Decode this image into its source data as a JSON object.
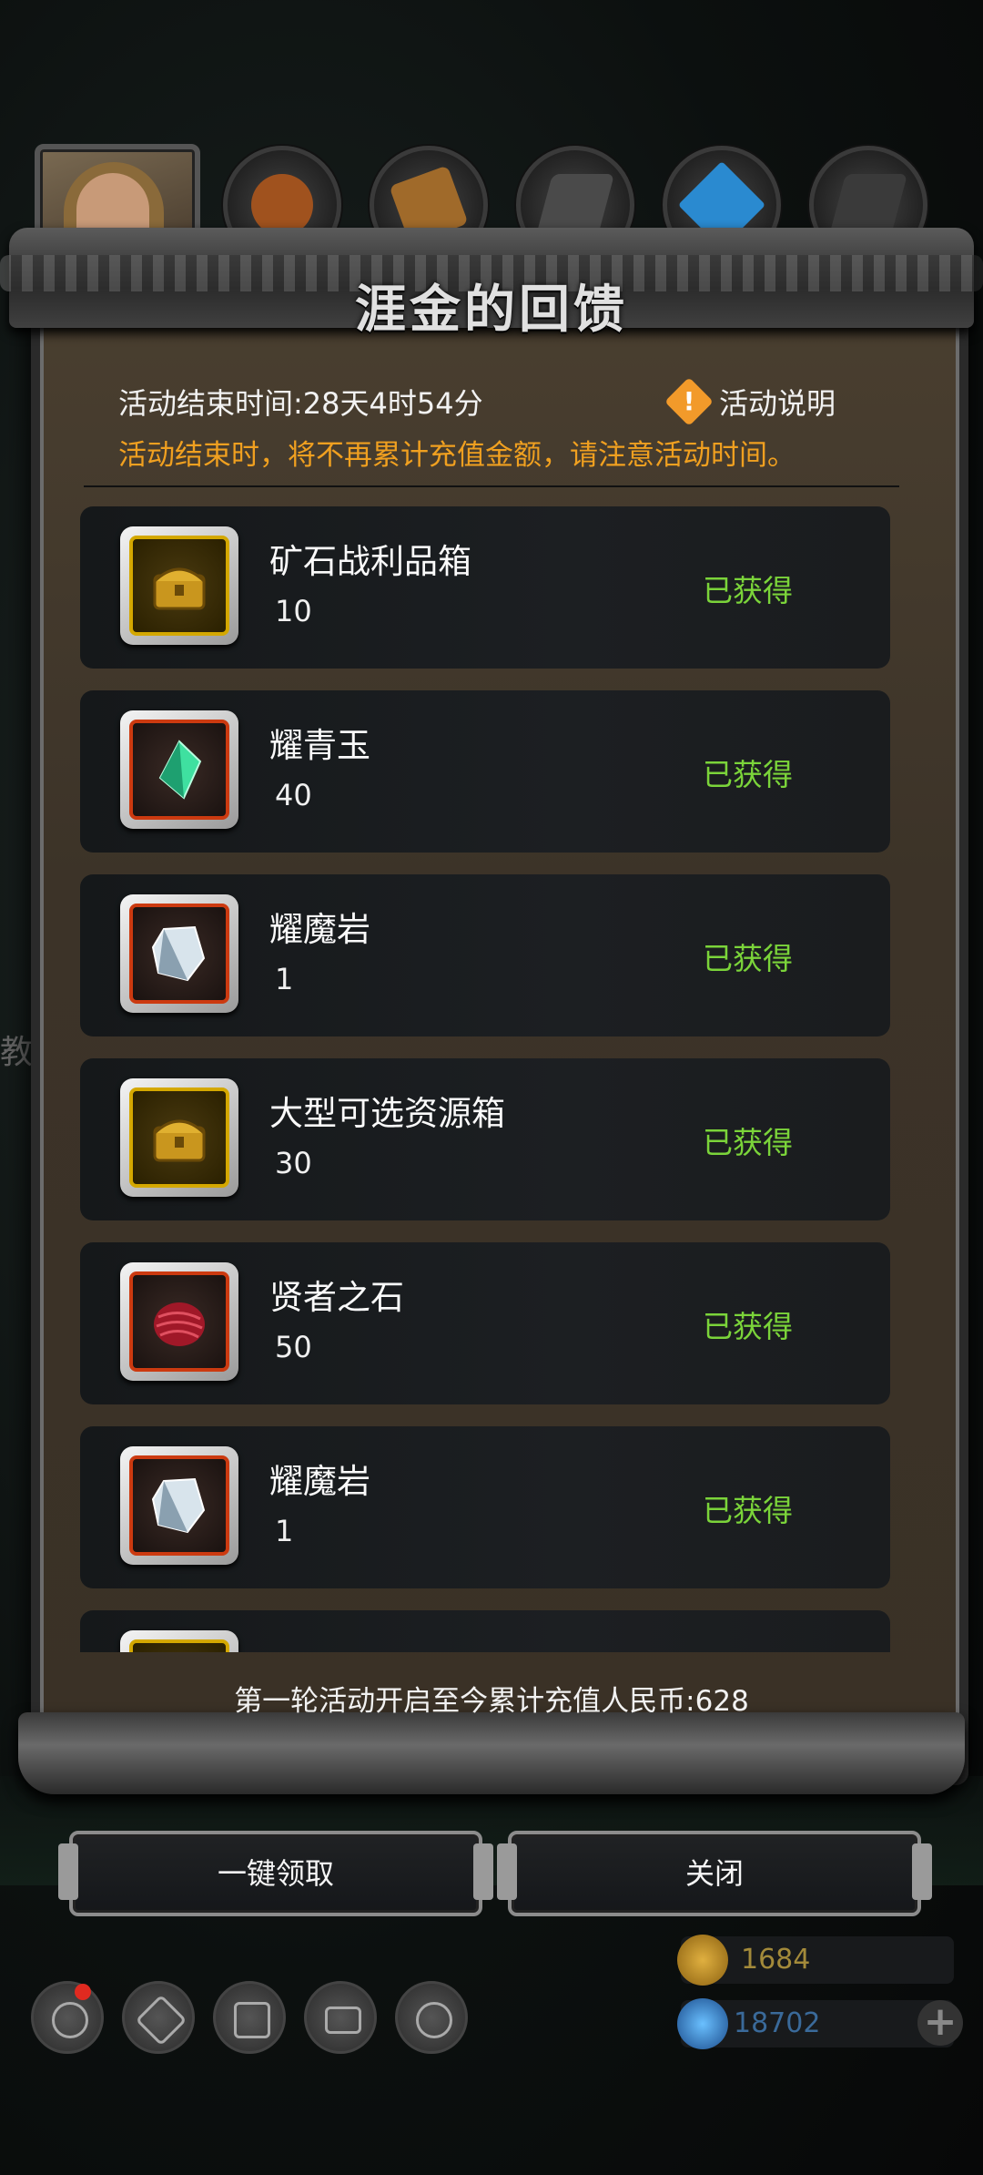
{
  "resources": [
    {
      "name": "copper-ore-icon",
      "color": "#a0521e",
      "value": ""
    },
    {
      "name": "wood-icon",
      "color": "#a06a2a",
      "value": ""
    },
    {
      "name": "iron-icon",
      "color": "#555555",
      "value": ""
    },
    {
      "name": "crystal-icon",
      "color": "#2a8ad0",
      "value": ""
    },
    {
      "name": "stone-icon",
      "color": "#3a3a3a",
      "value": ""
    }
  ],
  "dialog": {
    "title": "涯金的回馈",
    "end_time": "活动结束时间:28天4时54分",
    "help_label": "活动说明",
    "help_icon": "!",
    "notice": "活动结束时，将不再累计充值金额，请注意活动时间。",
    "total": "第一轮活动开启至今累计充值人民币:628"
  },
  "items": [
    {
      "name": "矿石战利品箱",
      "qty": "10",
      "status": "已获得",
      "frame": "gold",
      "icon": "chest-icon",
      "color": "#c9961e"
    },
    {
      "name": "耀青玉",
      "qty": "40",
      "status": "已获得",
      "frame": "red",
      "icon": "jade-crystal-icon",
      "color": "#3fe0a0"
    },
    {
      "name": "耀魔岩",
      "qty": "1",
      "status": "已获得",
      "frame": "red",
      "icon": "magic-rock-icon",
      "color": "#d8e4ec"
    },
    {
      "name": "大型可选资源箱",
      "qty": "30",
      "status": "已获得",
      "frame": "gold",
      "icon": "chest-icon",
      "color": "#c9961e"
    },
    {
      "name": "贤者之石",
      "qty": "50",
      "status": "已获得",
      "frame": "red",
      "icon": "sage-stone-icon",
      "color": "#a01828"
    },
    {
      "name": "耀魔岩",
      "qty": "1",
      "status": "已获得",
      "frame": "red",
      "icon": "magic-rock-icon",
      "color": "#d8e4ec"
    },
    {
      "name": "",
      "qty": "",
      "status": "",
      "frame": "gold",
      "icon": "chest-icon",
      "color": "#c9961e"
    }
  ],
  "buttons": {
    "claim_all": "一键领取",
    "close": "关闭"
  },
  "currency": {
    "gold": "1684",
    "gems": "18702"
  },
  "side_text": "教"
}
